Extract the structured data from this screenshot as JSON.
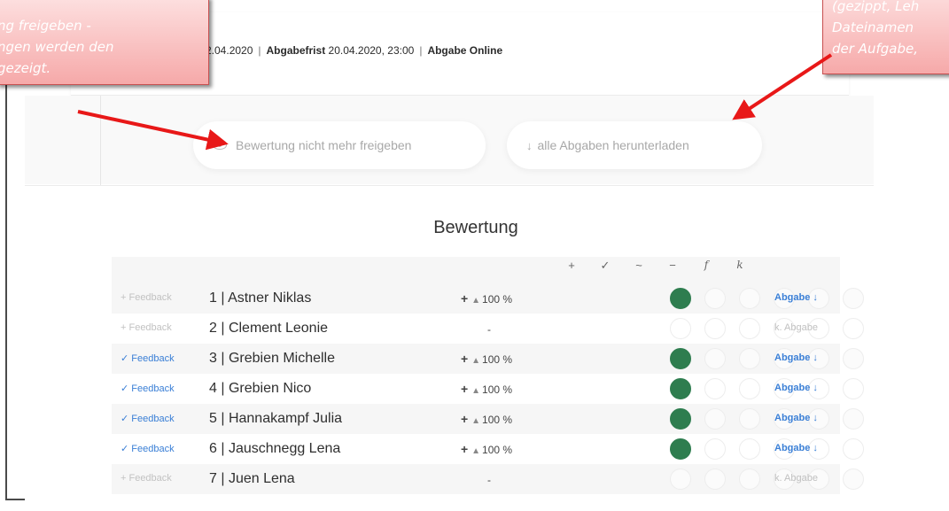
{
  "header": {
    "date_fragment": "2.04.2020",
    "deadline_label": "Abgabefrist",
    "deadline_value": "20.04.2020, 23:00",
    "mode": "Abgabe Online",
    "separator": "|"
  },
  "actions": {
    "release_label": "Bewertung nicht mehr freigeben",
    "download_label": "alle Abgaben herunterladen",
    "download_glyph": "↓"
  },
  "table": {
    "title": "Bewertung",
    "legend": [
      "+",
      "✓",
      "~",
      "−",
      "f",
      "k"
    ],
    "rows": [
      {
        "feedback": "+ Feedback",
        "student": "1 | Astner Niklas",
        "score_plus": "+",
        "score_tri": "▲",
        "score_pct": "100 %",
        "grade": "+",
        "abgabe": "Abgabe ↓"
      },
      {
        "feedback": "+ Feedback",
        "student": "2 | Clement Leonie",
        "score_plus": "",
        "score_tri": "",
        "score_pct": "-",
        "grade": "",
        "abgabe": "k. Abgabe"
      },
      {
        "feedback": "✓ Feedback",
        "student": "3 | Grebien Michelle",
        "score_plus": "+",
        "score_tri": "▲",
        "score_pct": "100 %",
        "grade": "+",
        "abgabe": "Abgabe ↓"
      },
      {
        "feedback": "✓ Feedback",
        "student": "4 | Grebien Nico",
        "score_plus": "+",
        "score_tri": "▲",
        "score_pct": "100 %",
        "grade": "+",
        "abgabe": "Abgabe ↓"
      },
      {
        "feedback": "✓ Feedback",
        "student": "5 | Hannakampf Julia",
        "score_plus": "+",
        "score_tri": "▲",
        "score_pct": "100 %",
        "grade": "+",
        "abgabe": "Abgabe ↓"
      },
      {
        "feedback": "✓ Feedback",
        "student": "6 | Jauschnegg Lena",
        "score_plus": "+",
        "score_tri": "▲",
        "score_pct": "100 %",
        "grade": "+",
        "abgabe": "Abgabe ↓"
      },
      {
        "feedback": "+ Feedback",
        "student": "7 | Juen Lena",
        "score_plus": "",
        "score_tri": "",
        "score_pct": "-",
        "grade": "",
        "abgabe": "k. Abgabe"
      }
    ]
  },
  "annotations": {
    "left_lines": [
      "ng freigeben -",
      "ngen werden den",
      "gezeigt."
    ],
    "right_lines": [
      "(gezippt, Leh",
      "Dateinamen",
      "der Aufgabe,"
    ]
  },
  "colors": {
    "grade_filled": "#2e7d4f",
    "link_blue": "#3a7fd6",
    "callout_fill": "#f6a9a9",
    "arrow_red": "#e81818"
  },
  "icons": {
    "release": "eye-icon",
    "download": "download-arrow-icon"
  }
}
